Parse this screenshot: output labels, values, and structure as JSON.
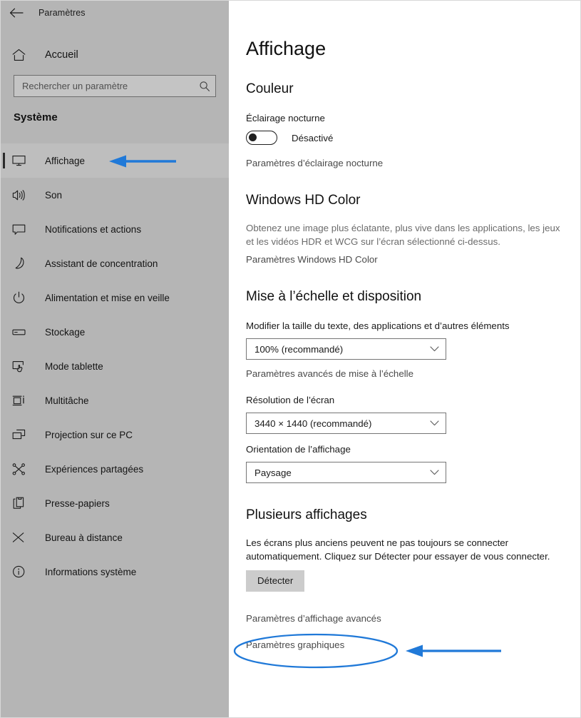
{
  "window": {
    "app_title": "Paramètres",
    "back_icon": "back-arrow-icon"
  },
  "sidebar": {
    "home": {
      "label": "Accueil",
      "icon": "home-icon"
    },
    "search": {
      "placeholder": "Rechercher un paramètre",
      "value": "",
      "icon": "search-icon"
    },
    "section_title": "Système",
    "items": [
      {
        "label": "Affichage",
        "icon": "monitor-icon",
        "selected": true
      },
      {
        "label": "Son",
        "icon": "speaker-icon",
        "selected": false
      },
      {
        "label": "Notifications et actions",
        "icon": "notification-icon",
        "selected": false
      },
      {
        "label": "Assistant de concentration",
        "icon": "moon-icon",
        "selected": false
      },
      {
        "label": "Alimentation et mise en veille",
        "icon": "power-icon",
        "selected": false
      },
      {
        "label": "Stockage",
        "icon": "drive-icon",
        "selected": false
      },
      {
        "label": "Mode tablette",
        "icon": "tablet-touch-icon",
        "selected": false
      },
      {
        "label": "Multitâche",
        "icon": "multitask-icon",
        "selected": false
      },
      {
        "label": "Projection sur ce PC",
        "icon": "projection-icon",
        "selected": false
      },
      {
        "label": "Expériences partagées",
        "icon": "share-nodes-icon",
        "selected": false
      },
      {
        "label": "Presse-papiers",
        "icon": "clipboard-icon",
        "selected": false
      },
      {
        "label": "Bureau à distance",
        "icon": "remote-desktop-icon",
        "selected": false
      },
      {
        "label": "Informations système",
        "icon": "info-icon",
        "selected": false
      }
    ]
  },
  "main": {
    "page_title": "Affichage",
    "color": {
      "heading": "Couleur",
      "night_light_label": "Éclairage nocturne",
      "night_light_state": "Désactivé",
      "night_light_on": false,
      "night_light_link": "Paramètres d’éclairage nocturne"
    },
    "hdr": {
      "heading": "Windows HD Color",
      "description": "Obtenez une image plus éclatante, plus vive dans les applications, les jeux et les vidéos HDR et WCG sur l’écran sélectionné ci-dessus.",
      "link": "Paramètres Windows HD Color"
    },
    "scale": {
      "heading": "Mise à l’échelle et disposition",
      "text_size_label": "Modifier la taille du texte, des applications et d’autres éléments",
      "text_size_value": "100% (recommandé)",
      "advanced_scaling_link": "Paramètres avancés de mise à l’échelle",
      "resolution_label": "Résolution de l’écran",
      "resolution_value": "3440 × 1440 (recommandé)",
      "orientation_label": "Orientation de l’affichage",
      "orientation_value": "Paysage"
    },
    "multi": {
      "heading": "Plusieurs affichages",
      "description": "Les écrans plus anciens peuvent ne pas toujours se connecter automatiquement. Cliquez sur Détecter pour essayer de vous connecter.",
      "detect_button": "Détecter",
      "advanced_display_link": "Paramètres d’affichage avancés",
      "graphics_link": "Paramètres graphiques"
    }
  },
  "annotations": {
    "color": "#2079d8",
    "arrow_sidebar": {
      "name": "arrow-to-affichage"
    },
    "arrow_advanced": {
      "name": "arrow-to-advanced-display-settings"
    },
    "ellipse_advanced": {
      "name": "ellipse-around-advanced-display-settings"
    }
  }
}
